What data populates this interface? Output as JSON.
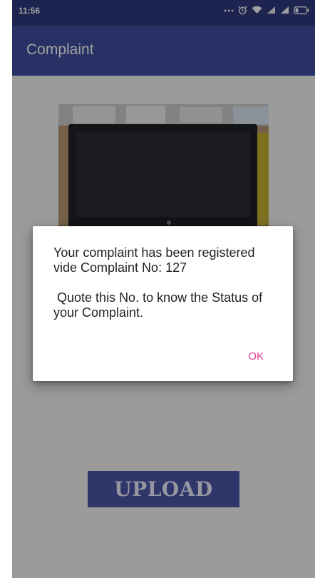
{
  "status_bar": {
    "time": "11:56",
    "icons": [
      "more-dots-icon",
      "alarm-icon",
      "wifi-icon",
      "signal-icon",
      "signal-icon",
      "battery-icon"
    ]
  },
  "app_bar": {
    "title": "Complaint"
  },
  "content": {
    "photo_icon": "monitor-photo",
    "upload_label": "UPLOAD"
  },
  "dialog": {
    "message": "Your complaint has been registered vide Complaint No: 127\n\n Quote this No. to know the Status of your Complaint.",
    "ok_label": "OK"
  },
  "colors": {
    "status_bar": "#2f3a7d",
    "app_bar": "#3f4fa0",
    "upload_button": "#4a56a8",
    "dialog_accent": "#e0409a"
  }
}
